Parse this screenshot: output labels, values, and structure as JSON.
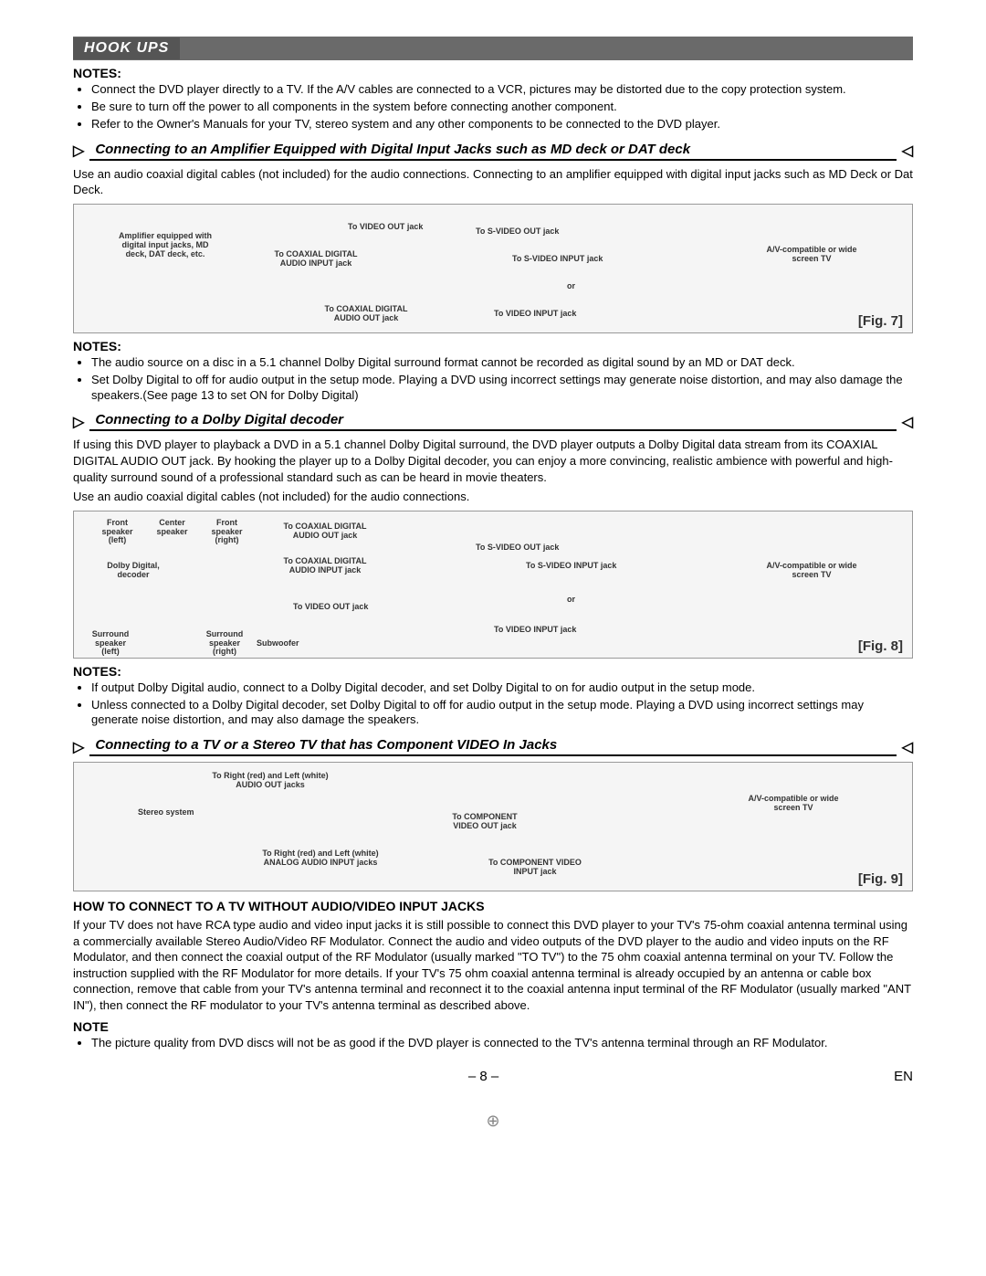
{
  "header": {
    "title": "HOOK UPS"
  },
  "notes1": {
    "heading": "NOTES:",
    "items": [
      "Connect the DVD player directly to a TV. If the A/V cables are connected to a VCR, pictures may be distorted due to the copy protection system.",
      "Be sure to turn off the power to all components in the system before connecting another component.",
      "Refer to the Owner's Manuals for your TV, stereo system and any other components to be connected to the DVD player."
    ]
  },
  "section1": {
    "title": "Connecting to an Amplifier Equipped with Digital Input Jacks such as MD deck or DAT deck",
    "intro": "Use an audio coaxial digital cables (not included) for the audio connections. Connecting to an amplifier equipped with digital input jacks such as MD Deck or Dat Deck.",
    "diagram": {
      "labels": {
        "amp": "Amplifier equipped with digital input jacks, MD deck, DAT deck, etc.",
        "to_video_out": "To VIDEO OUT jack",
        "to_coax_in": "To COAXIAL DIGITAL AUDIO INPUT jack",
        "to_coax_out": "To COAXIAL DIGITAL AUDIO OUT jack",
        "to_svideo_out": "To S-VIDEO OUT jack",
        "to_svideo_in": "To S-VIDEO INPUT jack",
        "to_video_in": "To VIDEO INPUT jack",
        "or": "or",
        "tv": "A/V-compatible or wide screen TV"
      },
      "fig": "[Fig. 7]"
    }
  },
  "notes2": {
    "heading": "NOTES:",
    "items": [
      "The audio source on a disc in a 5.1 channel Dolby Digital surround format cannot be recorded as digital sound by an MD or DAT deck.",
      "Set Dolby Digital to off for audio output in the setup mode. Playing a DVD using incorrect settings may generate noise distortion, and may also damage the speakers.(See page 13 to set ON for Dolby Digital)"
    ]
  },
  "section2": {
    "title": "Connecting to a Dolby Digital decoder",
    "intro1": "If using this DVD player to playback a DVD in a 5.1 channel Dolby Digital surround, the DVD player outputs a Dolby Digital data stream from its COAXIAL DIGITAL AUDIO OUT jack. By hooking the player up to a Dolby Digital decoder, you can enjoy a more convincing, realistic ambience with powerful and high-quality surround sound of a professional standard such as can be heard in movie theaters.",
    "intro2": "Use an audio coaxial digital cables (not included) for the audio connections.",
    "diagram": {
      "labels": {
        "front_left": "Front speaker (left)",
        "center": "Center speaker",
        "front_right": "Front speaker (right)",
        "dolby": "Dolby Digital, decoder",
        "surr_left": "Surround speaker (left)",
        "surr_right": "Surround speaker (right)",
        "sub": "Subwoofer",
        "to_coax_out": "To COAXIAL DIGITAL AUDIO OUT jack",
        "to_coax_in": "To COAXIAL DIGITAL AUDIO INPUT jack",
        "to_video_out": "To VIDEO OUT jack",
        "to_svideo_out": "To S-VIDEO OUT jack",
        "to_svideo_in": "To S-VIDEO INPUT jack",
        "to_video_in": "To VIDEO INPUT jack",
        "or": "or",
        "tv": "A/V-compatible or wide screen TV"
      },
      "fig": "[Fig. 8]"
    }
  },
  "notes3": {
    "heading": "NOTES:",
    "items": [
      "If output Dolby Digital audio, connect to a Dolby Digital decoder, and set Dolby Digital to on for audio output in the setup mode.",
      "Unless connected to a Dolby Digital decoder, set Dolby Digital to off for audio output in the setup mode. Playing a DVD using incorrect settings may generate noise distortion, and may also damage the speakers."
    ]
  },
  "section3": {
    "title": "Connecting to a TV or a Stereo TV that has Component VIDEO In Jacks",
    "diagram": {
      "labels": {
        "stereo": "Stereo system",
        "to_audio_out": "To Right (red) and Left (white) AUDIO OUT jacks",
        "to_audio_in": "To Right (red) and Left (white) ANALOG AUDIO INPUT jacks",
        "to_comp_out": "To COMPONENT VIDEO OUT jack",
        "to_comp_in": "To COMPONENT VIDEO INPUT jack",
        "tv": "A/V-compatible or wide screen TV"
      },
      "fig": "[Fig. 9]"
    }
  },
  "howto": {
    "heading": "HOW TO CONNECT TO A TV WITHOUT AUDIO/VIDEO INPUT JACKS",
    "body": "If your TV does not have RCA type audio and video input jacks it is still possible to connect this DVD player to your TV's 75-ohm coaxial antenna terminal using a commercially available Stereo Audio/Video RF Modulator. Connect the audio and video outputs of the DVD player to the audio and video inputs on the RF Modulator, and then connect the coaxial output of the RF Modulator (usually marked \"TO TV\") to the 75 ohm coaxial antenna terminal on your TV. Follow the instruction supplied with the RF Modulator for more details. If your TV's 75 ohm coaxial antenna terminal is already occupied by an antenna or cable box connection, remove that cable from your TV's antenna terminal and reconnect it to the coaxial antenna input terminal of the RF Modulator (usually marked \"ANT IN\"), then connect the RF modulator to your TV's antenna terminal as described above."
  },
  "note_final": {
    "heading": "NOTE",
    "items": [
      "The picture quality from DVD discs will not be as good if the DVD player is connected to the TV's antenna terminal through an RF Modulator."
    ]
  },
  "footer": {
    "page": "– 8 –",
    "lang": "EN"
  }
}
